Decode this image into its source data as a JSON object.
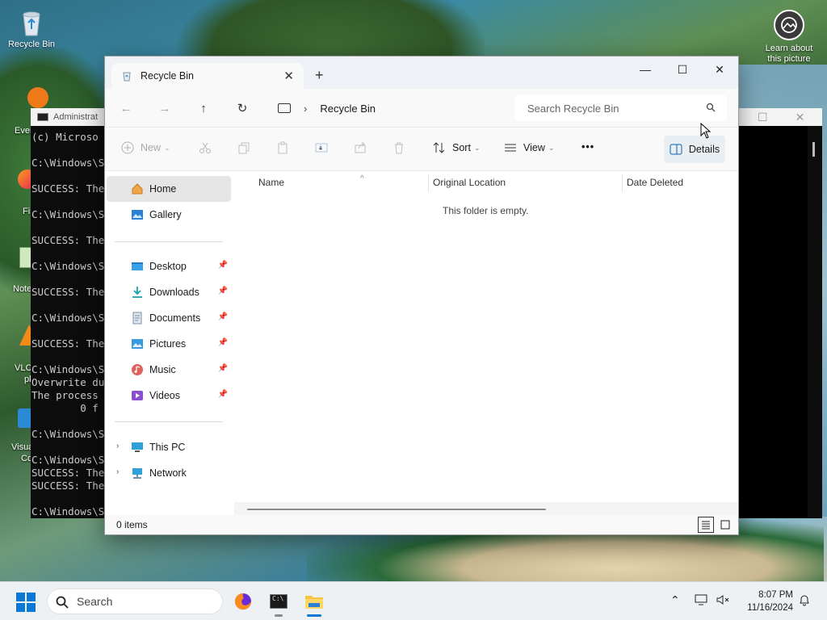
{
  "desktop": {
    "recycle_bin_label": "Recycle Bin",
    "learn_label": "Learn about this picture",
    "side_labels": [
      "Every",
      "Fire",
      "Note",
      "VLC r",
      "pla",
      "Visual",
      "Co"
    ]
  },
  "cmd": {
    "title": "Administrat",
    "lines": [
      "(c) Microso",
      "",
      "C:\\Windows\\S",
      "",
      "SUCCESS: The",
      "",
      "C:\\Windows\\S",
      "",
      "SUCCESS: The",
      "",
      "C:\\Windows\\S",
      "",
      "SUCCESS: The",
      "",
      "C:\\Windows\\S",
      "",
      "SUCCESS: The",
      "",
      "C:\\Windows\\S",
      "Overwrite du",
      "The process",
      "        0 f",
      "",
      "C:\\Windows\\S",
      "",
      "C:\\Windows\\S",
      "SUCCESS: The",
      "SUCCESS: The",
      "",
      "C:\\Windows\\S"
    ]
  },
  "explorer": {
    "tab_title": "Recycle Bin",
    "address": "Recycle Bin",
    "search_placeholder": "Search Recycle Bin",
    "toolbar": {
      "new": "New",
      "sort": "Sort",
      "view": "View",
      "more": "•••",
      "details": "Details"
    },
    "sidebar": {
      "home": "Home",
      "gallery": "Gallery",
      "desktop": "Desktop",
      "downloads": "Downloads",
      "documents": "Documents",
      "pictures": "Pictures",
      "music": "Music",
      "videos": "Videos",
      "this_pc": "This PC",
      "network": "Network"
    },
    "columns": {
      "name": "Name",
      "original_location": "Original Location",
      "date_deleted": "Date Deleted"
    },
    "empty_message": "This folder is empty.",
    "status": "0 items"
  },
  "taskbar": {
    "search_label": "Search",
    "time": "8:07 PM",
    "date": "11/16/2024"
  },
  "colors": {
    "accent": "#0a78d4",
    "sidebar_selected": "#e5e5e5"
  }
}
